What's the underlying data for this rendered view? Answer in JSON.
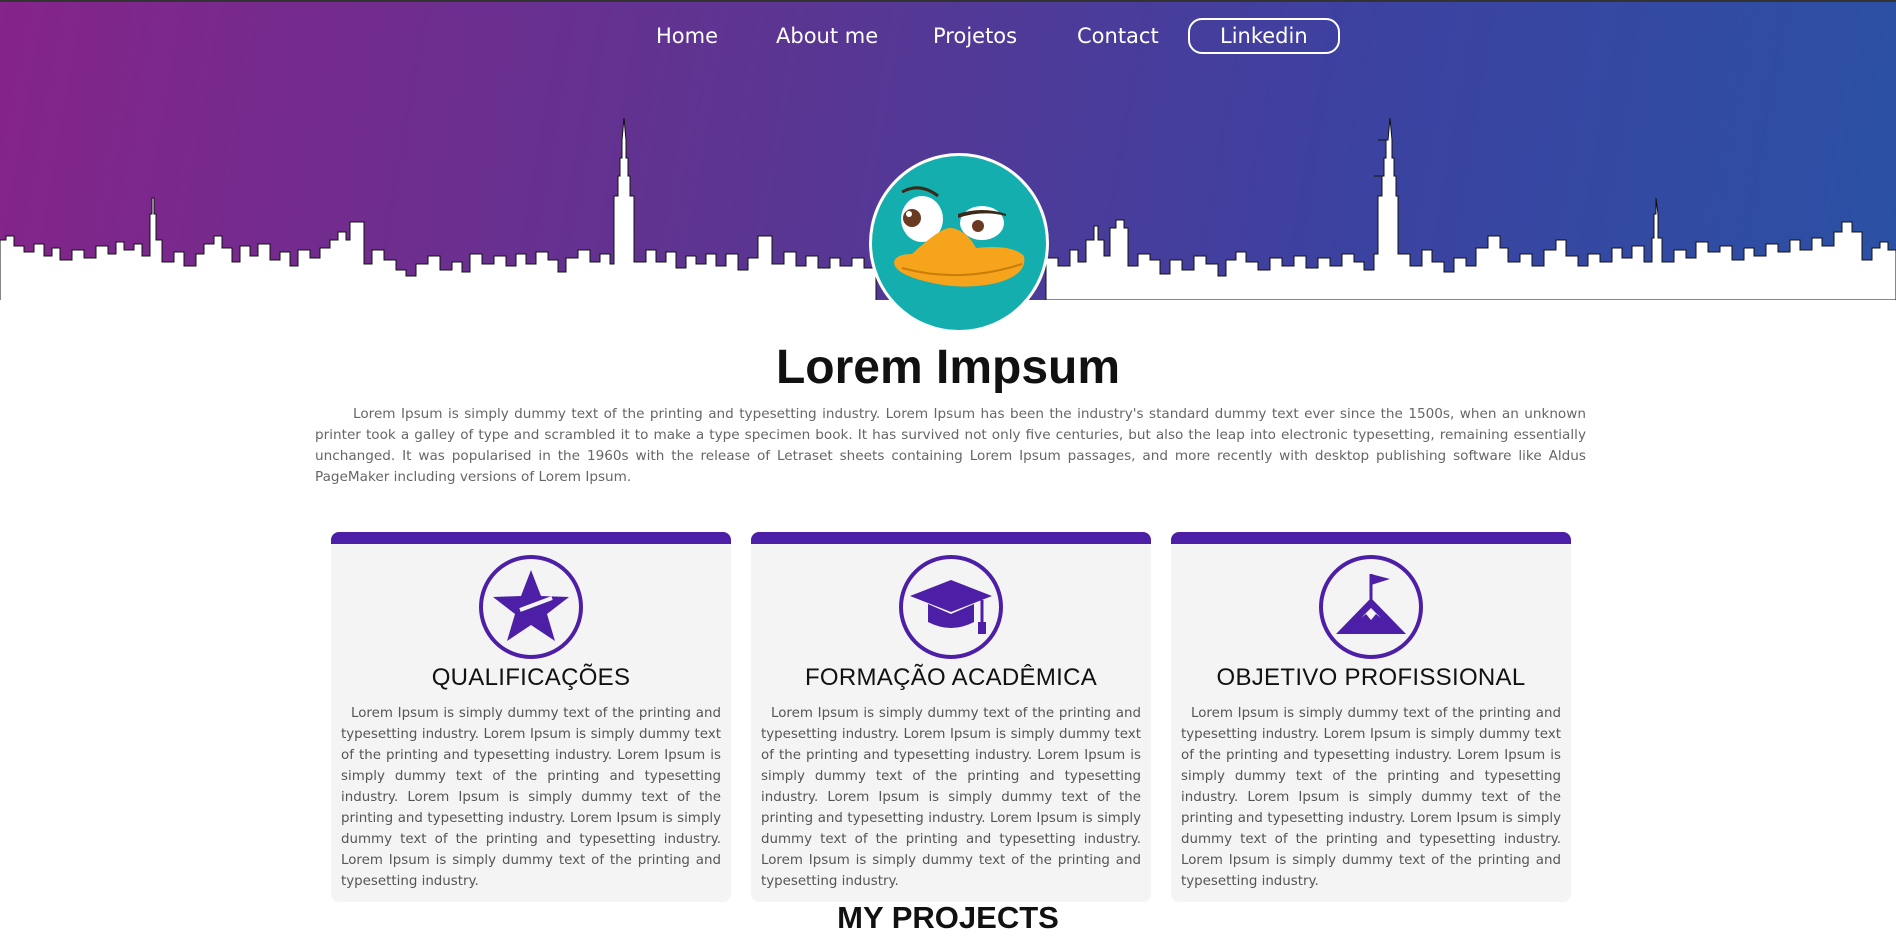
{
  "nav": {
    "items": [
      "Home",
      "About me",
      "Projetos",
      "Contact"
    ],
    "linkedin": "Linkedin"
  },
  "profile": {
    "name": "Lorem Impsum",
    "intro": "Lorem Ipsum is simply dummy text of the printing and typesetting industry. Lorem Ipsum has been the industry's standard dummy text ever since the 1500s, when an unknown printer took a galley of type and scrambled it to make a type specimen book. It has survived not only five centuries, but also the leap into electronic typesetting, remaining essentially unchanged. It was popularised in the 1960s with the release of Letraset sheets containing Lorem Ipsum passages, and more recently with desktop publishing software like Aldus PageMaker including versions of Lorem Ipsum."
  },
  "cards": [
    {
      "icon": "star-badge-icon",
      "title": "QUALIFICAÇÕES",
      "text": "Lorem Ipsum is simply dummy text of the printing and typesetting industry. Lorem Ipsum is simply dummy text of the printing and typesetting industry. Lorem Ipsum is simply dummy text of the printing and typesetting industry. Lorem Ipsum is simply dummy text of the printing and typesetting industry. Lorem Ipsum is simply dummy text of the printing and typesetting industry. Lorem Ipsum is simply dummy text of the printing and typesetting industry."
    },
    {
      "icon": "graduation-cap-icon",
      "title": "FORMAÇÃO ACADÊMICA",
      "text": "Lorem Ipsum is simply dummy text of the printing and typesetting industry. Lorem Ipsum is simply dummy text of the printing and typesetting industry. Lorem Ipsum is simply dummy text of the printing and typesetting industry. Lorem Ipsum is simply dummy text of the printing and typesetting industry. Lorem Ipsum is simply dummy text of the printing and typesetting industry. Lorem Ipsum is simply dummy text of the printing and typesetting industry."
    },
    {
      "icon": "mountain-flag-icon",
      "title": "OBJETIVO PROFISSIONAL",
      "text": "Lorem Ipsum is simply dummy text of the printing and typesetting industry. Lorem Ipsum is simply dummy text of the printing and typesetting industry. Lorem Ipsum is simply dummy text of the printing and typesetting industry. Lorem Ipsum is simply dummy text of the printing and typesetting industry. Lorem Ipsum is simply dummy text of the printing and typesetting industry. Lorem Ipsum is simply dummy text of the printing and typesetting industry."
    }
  ],
  "projects": {
    "heading": "MY PROJECTS"
  },
  "colors": {
    "gradient_start": "#85248a",
    "gradient_end": "#2a51a4",
    "accent": "#4d1fa6",
    "avatar_bg": "#14aeae",
    "beak": "#f5a41c"
  }
}
